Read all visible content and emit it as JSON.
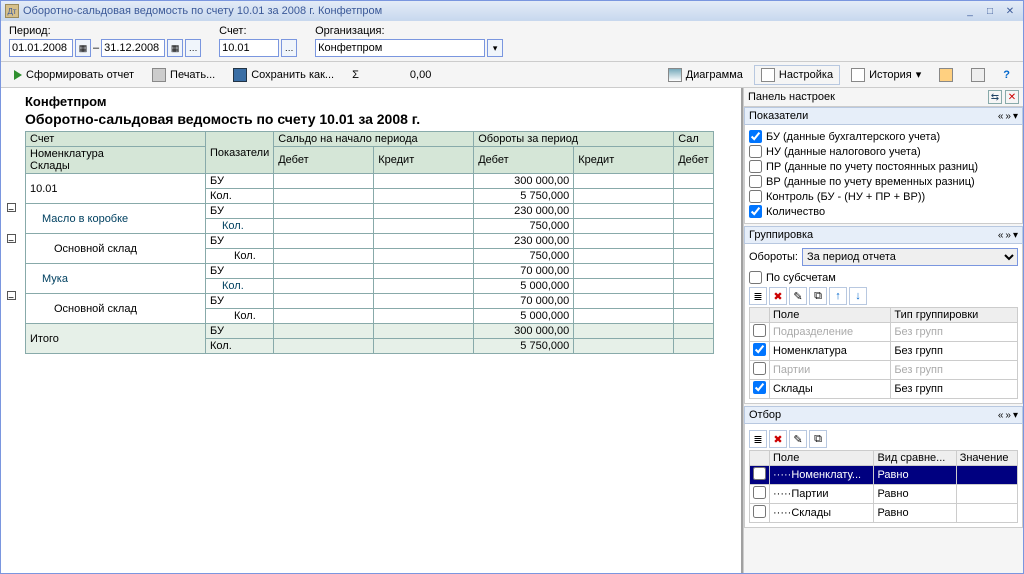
{
  "window": {
    "title": "Оборотно-сальдовая ведомость по счету 10.01 за 2008 г. Конфетпром"
  },
  "params": {
    "period_label": "Период:",
    "date_from": "01.01.2008",
    "date_to": "31.12.2008",
    "dash": "–",
    "account_label": "Счет:",
    "account": "10.01",
    "org_label": "Организация:",
    "org": "Конфетпром"
  },
  "toolbar": {
    "form": "Сформировать отчет",
    "print": "Печать...",
    "saveas": "Сохранить как...",
    "sigma": "Σ",
    "sum": "0,00",
    "diagram": "Диаграмма",
    "settings": "Настройка",
    "history": "История"
  },
  "report": {
    "org": "Конфетпром",
    "title": "Оборотно-сальдовая ведомость по счету 10.01 за 2008 г.",
    "headers": {
      "acct": "Счет",
      "pokaz": "Показатели",
      "snp": "Сальдо на начало периода",
      "ozp": "Обороты за период",
      "sal": "Сал",
      "nomen": "Номенклатура",
      "sklad": "Склады",
      "deb": "Дебет",
      "kre": "Кредит",
      "itogo": "Итого"
    },
    "rows": [
      {
        "lvl": 0,
        "name": "10.01",
        "bu": "БУ",
        "bu_dob": "300 000,00",
        "kol": "Кол.",
        "kol_dob": "5 750,000"
      },
      {
        "lvl": 1,
        "name": "Масло в коробке",
        "bu": "БУ",
        "bu_dob": "230 000,00",
        "kol": "Кол.",
        "kol_dob": "750,000"
      },
      {
        "lvl": 2,
        "name": "Основной склад",
        "bu": "БУ",
        "bu_dob": "230 000,00",
        "kol": "Кол.",
        "kol_dob": "750,000"
      },
      {
        "lvl": 1,
        "name": "Мука",
        "bu": "БУ",
        "bu_dob": "70 000,00",
        "kol": "Кол.",
        "kol_dob": "5 000,000"
      },
      {
        "lvl": 2,
        "name": "Основной склад",
        "bu": "БУ",
        "bu_dob": "70 000,00",
        "kol": "Кол.",
        "kol_dob": "5 000,000"
      }
    ],
    "totals": {
      "name": "Итого",
      "bu": "БУ",
      "bu_dob": "300 000,00",
      "kol": "Кол.",
      "kol_dob": "5 750,000"
    }
  },
  "panel": {
    "header": "Панель настроек",
    "pokaz": {
      "title": "Показатели",
      "bu": "БУ (данные бухгалтерского учета)",
      "nu": "НУ (данные налогового учета)",
      "pr": "ПР (данные по учету постоянных разниц)",
      "vr": "ВР (данные по учету временных разниц)",
      "ctrl": "Контроль (БУ - (НУ + ПР + ВР))",
      "qty": "Количество"
    },
    "group": {
      "title": "Группировка",
      "obor_label": "Обороты:",
      "obor_value": "За период отчета",
      "subacc": "По субсчетам",
      "col_field": "Поле",
      "col_type": "Тип группировки",
      "rows": [
        {
          "chk": false,
          "name": "Подразделение",
          "type": "Без групп",
          "dis": true
        },
        {
          "chk": true,
          "name": "Номенклатура",
          "type": "Без групп"
        },
        {
          "chk": false,
          "name": "Партии",
          "type": "Без групп",
          "dis": true
        },
        {
          "chk": true,
          "name": "Склады",
          "type": "Без групп"
        }
      ]
    },
    "filter": {
      "title": "Отбор",
      "col_field": "Поле",
      "col_comp": "Вид сравне...",
      "col_val": "Значение",
      "rows": [
        {
          "name": "Номенклату...",
          "comp": "Равно",
          "sel": true
        },
        {
          "name": "Партии",
          "comp": "Равно"
        },
        {
          "name": "Склады",
          "comp": "Равно"
        }
      ]
    }
  }
}
